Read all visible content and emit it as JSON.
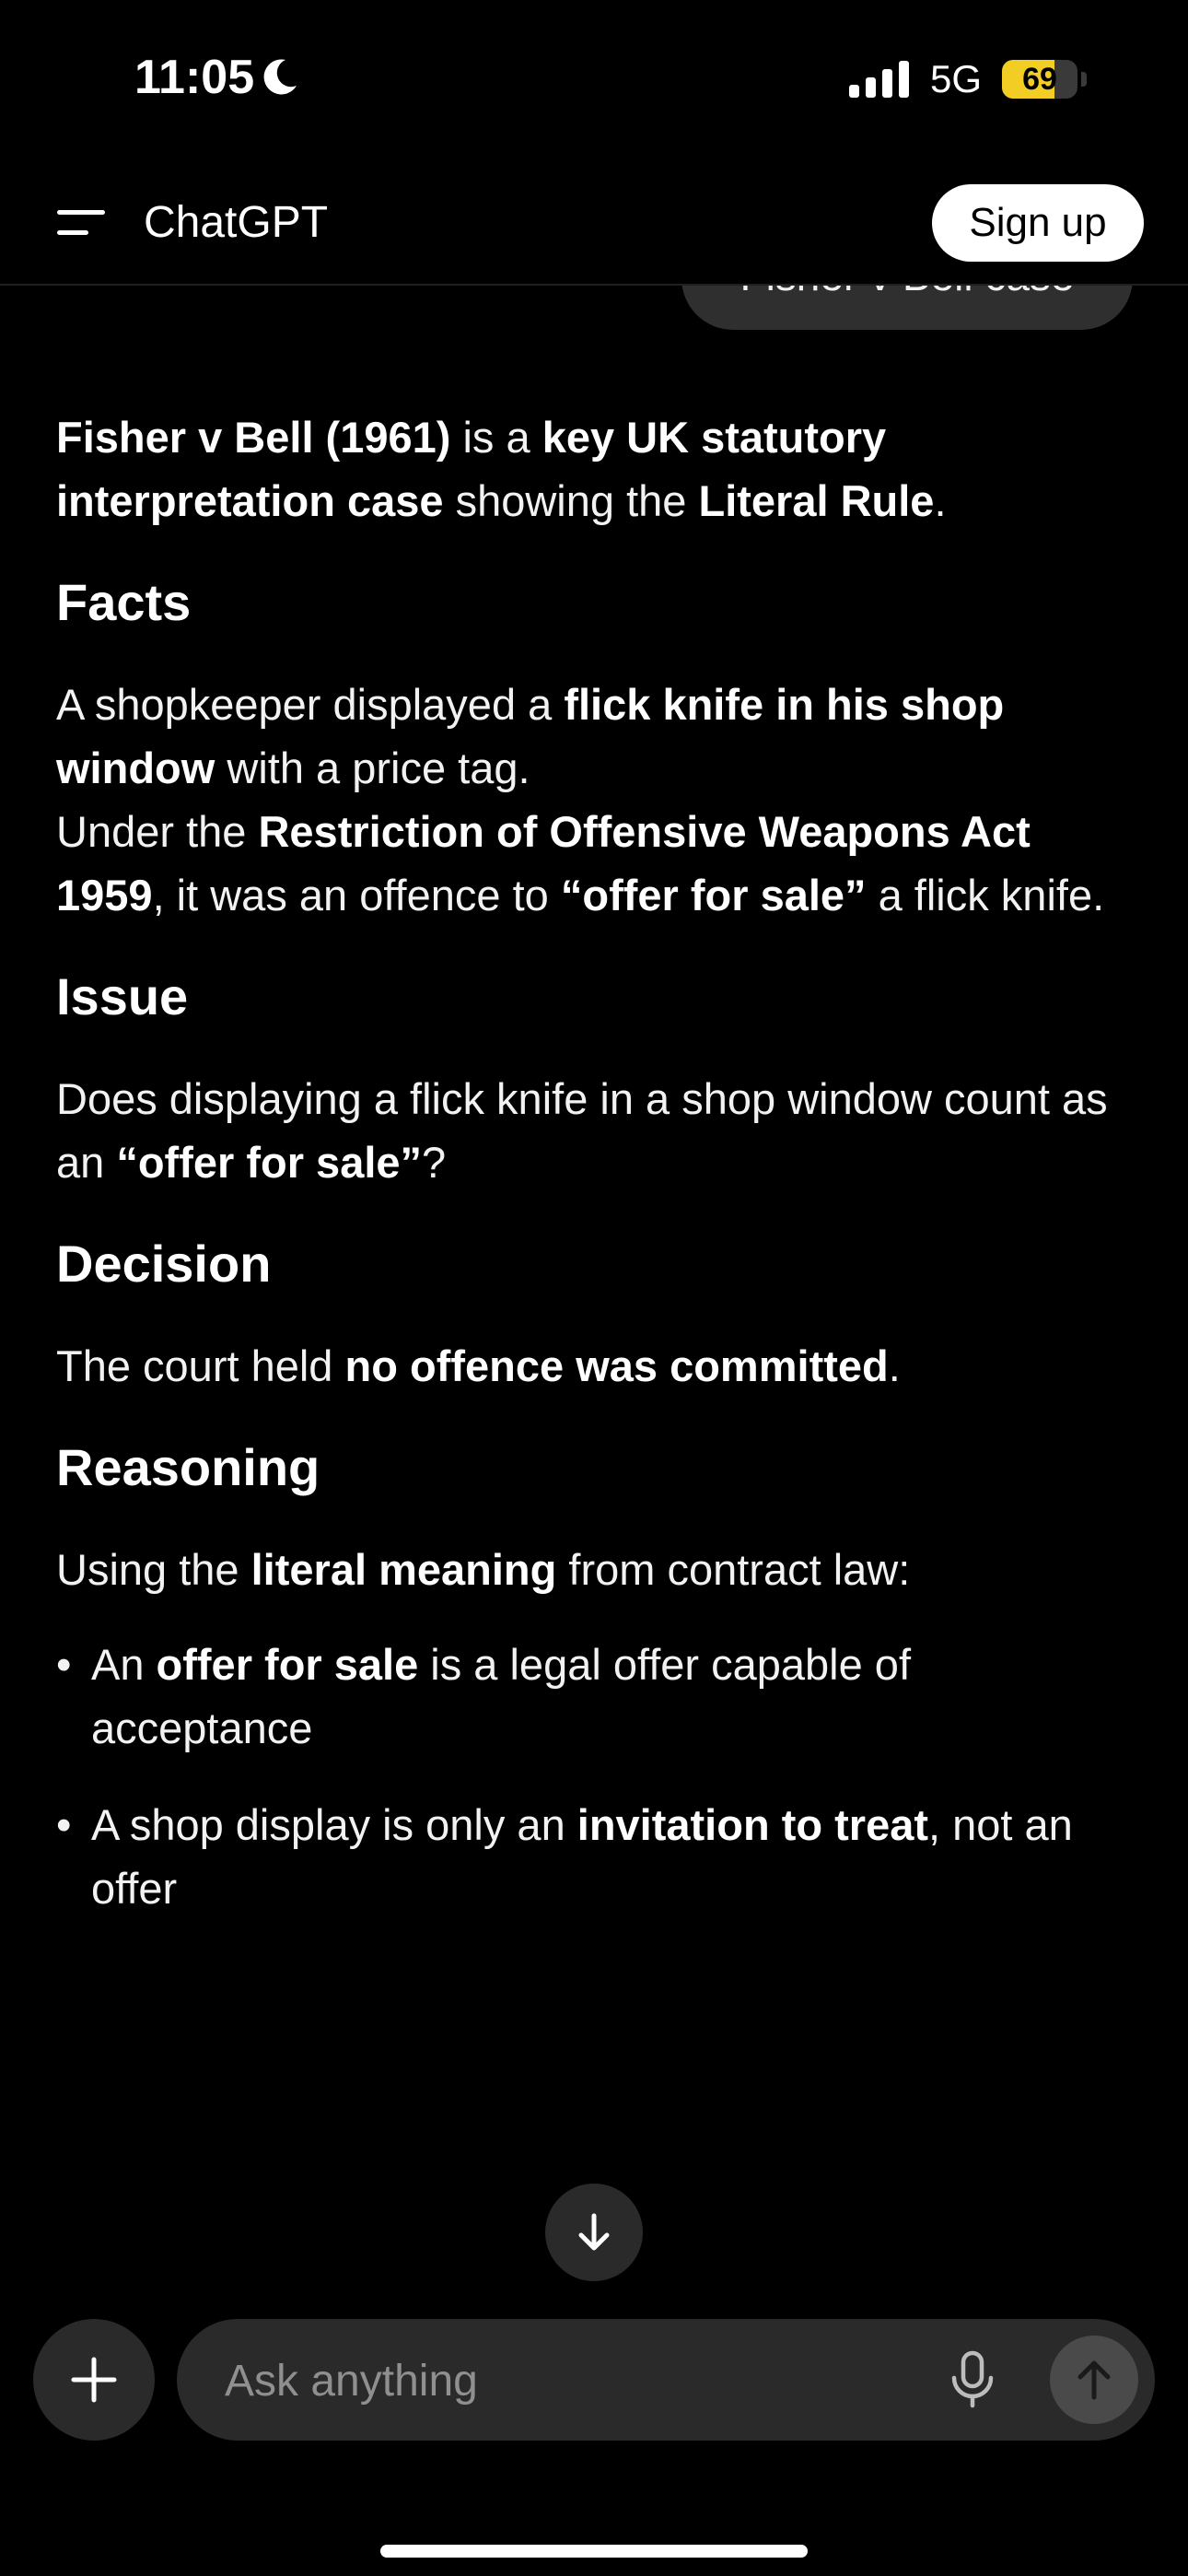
{
  "status_bar": {
    "time": "11:05",
    "network": "5G",
    "battery": "69",
    "battery_level": 0.69
  },
  "header": {
    "title": "ChatGPT",
    "signup_label": "Sign up"
  },
  "user_message": "Fisher v Bell case",
  "answer": {
    "intro": {
      "b1": "Fisher v Bell (1961)",
      "t1": " is a ",
      "b2": "key UK statutory interpretation case",
      "t2": " showing the ",
      "b3": "Literal Rule",
      "t3": "."
    },
    "facts": {
      "heading": "Facts",
      "p1": {
        "t1": "A shopkeeper displayed a ",
        "b1": "flick knife in his shop window",
        "t2": " with a price tag."
      },
      "p2": {
        "t1": "Under the ",
        "b1": "Restriction of Offensive Weapons Act 1959",
        "t2": ", it was an offence to ",
        "b2": "“offer for sale”",
        "t3": " a flick knife."
      }
    },
    "issue": {
      "heading": "Issue",
      "t1": "Does displaying a flick knife in a shop window count as an ",
      "b1": "“offer for sale”",
      "t2": "?"
    },
    "decision": {
      "heading": "Decision",
      "t1": "The court held ",
      "b1": "no offence was committed",
      "t2": "."
    },
    "reasoning": {
      "heading": "Reasoning",
      "intro": {
        "t1": "Using the ",
        "b1": "literal meaning",
        "t2": " from contract law:"
      },
      "bullets": [
        {
          "t1": "An ",
          "b1": "offer for sale",
          "t2": " is a legal offer capable of acceptance"
        },
        {
          "t1": "A shop display is only an ",
          "b1": "invitation to treat",
          "t2": ", not an offer"
        }
      ]
    }
  },
  "composer": {
    "placeholder": "Ask anything"
  },
  "icons": {
    "menu": "menu-icon",
    "moon": "moon-icon",
    "signal": "signal-icon",
    "scroll_down": "arrow-down-icon",
    "plus": "plus-icon",
    "mic": "microphone-icon",
    "send": "arrow-up-icon"
  }
}
